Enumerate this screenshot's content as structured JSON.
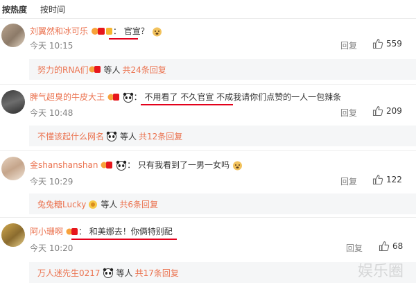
{
  "tabs": {
    "hot": "按热度",
    "time": "按时间"
  },
  "comments": [
    {
      "username": "刘翼然和冰可乐",
      "text": "官宣？",
      "time": "今天 10:15",
      "reply": "回复",
      "likes": "559",
      "sub": {
        "name": "努力的RNA们",
        "etc": "等人",
        "more": "共24条回复"
      }
    },
    {
      "username": "脾气超臭的牛皮大王",
      "text": "不用看了 不久官宣 不成我请你们点赞的一人一包辣条",
      "time": "今天 10:48",
      "reply": "回复",
      "likes": "209",
      "sub": {
        "name": "不懂该起什么网名",
        "etc": "等人",
        "more": "共12条回复"
      }
    },
    {
      "username": "金shanshanshan",
      "text": "只有我看到了一男一女吗",
      "time": "今天 10:29",
      "reply": "回复",
      "likes": "122",
      "sub": {
        "name": "兔兔糖Lucky",
        "etc": "等人",
        "more": "共6条回复"
      }
    },
    {
      "username": "阿小珊啊",
      "text": "和美娜去！你俩特别配",
      "time": "今天 10:20",
      "reply": "回复",
      "likes": "68",
      "sub": {
        "name": "万人迷先生0217",
        "etc": "等人",
        "more": "共17条回复"
      }
    }
  ],
  "colors": {
    "username": "#eb7350",
    "underline": "#e3001b",
    "subbox": "#f5f6f7"
  },
  "icons": [
    "thumb-up-icon",
    "panda-emoji",
    "doge-emoji",
    "vip-badge-icon"
  ],
  "watermark": "娱乐圈"
}
